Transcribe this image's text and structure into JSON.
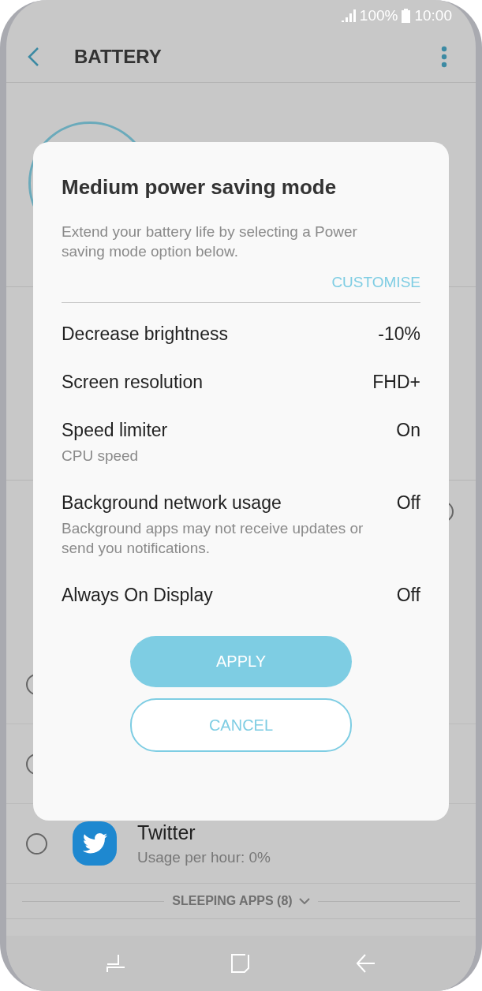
{
  "status_bar": {
    "battery": "100%",
    "time": "10:00"
  },
  "header": {
    "title": "BATTERY"
  },
  "side_radio": {
    "selected": false
  },
  "covered_rows": [
    {
      "selected": false
    },
    {
      "selected": false
    }
  ],
  "apps": [
    {
      "name": "Twitter",
      "usage": "Usage per hour: 0%",
      "selected": false
    }
  ],
  "sleeping_apps": {
    "label": "SLEEPING APPS (8)",
    "expanded": false
  },
  "dialog": {
    "title": "Medium power saving mode",
    "description": "Extend your battery life by selecting a Power saving mode option below.",
    "link": "CUSTOMISE",
    "options": [
      {
        "label": "Decrease brightness",
        "value": "-10%"
      },
      {
        "label": "Screen resolution",
        "value": "FHD+"
      },
      {
        "label": "Speed limiter",
        "value": "On",
        "note": "CPU speed"
      },
      {
        "label": "Background network usage",
        "value": "Off",
        "note": "Background apps may not receive updates or send you notifications."
      },
      {
        "label": "Always On Display",
        "value": "Off"
      }
    ],
    "buttons": [
      {
        "label": "APPLY",
        "kind": "filled"
      },
      {
        "label": "CANCEL",
        "kind": "outline"
      }
    ]
  }
}
